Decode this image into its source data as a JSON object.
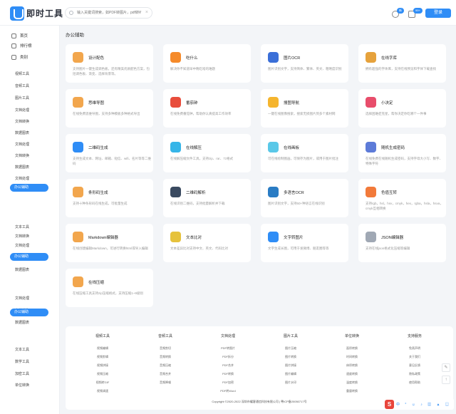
{
  "header": {
    "brand": "即时工具",
    "search_placeholder": "输入关键词搜索，如PDF转图片，pdf转Word等",
    "badge1": "新",
    "badge2": "99+",
    "login": "登录"
  },
  "colors": {
    "accent": "#2f8df6"
  },
  "sidebar": {
    "home": "首页",
    "rank": "排行榜",
    "category": "类别",
    "items": [
      "视频工具",
      "音频工具",
      "图片工具",
      "文档处理",
      "文档转换",
      "数据图表",
      "文档处理",
      "文档转换",
      "数据图表",
      "文档处理",
      "文档转换",
      "办公辅助",
      "文本工具",
      "文档转换",
      "文档处理",
      "文档转换",
      "数据图表",
      "办公辅助",
      "文档处理",
      "文档转换",
      "数据图表",
      "办公辅助",
      "文本工具",
      "数学工具",
      "加密工具",
      "单位转换"
    ]
  },
  "section_title": "办公辅助",
  "cards": [
    {
      "title": "设计配色",
      "desc": "支持图片一键生成调色板，还有精美优质配色方案，包括调色板、渐变、选择背景等。",
      "icon": "palette-icon",
      "color": "#f2a64d"
    },
    {
      "title": "吃什么",
      "desc": "解决你不知道早中晚吃啥的难题",
      "icon": "food-icon",
      "color": "#f58a2a"
    },
    {
      "title": "图片OCR",
      "desc": "图片识别文字，支持简体、繁体、英文、粗略度识别",
      "icon": "ocr-icon",
      "color": "#3b6fd8"
    },
    {
      "title": "在线字库",
      "desc": "拥有超强的字体库，支持在线预览和字体下载查找",
      "icon": "font-library-icon",
      "color": "#e6a23c"
    },
    {
      "title": "思维导图",
      "desc": "在线免费思维导图，支持多种模板多种格式导出",
      "icon": "mindmap-icon",
      "color": "#f2a64d"
    },
    {
      "title": "番茄钟",
      "desc": "在线免费番茄钟，帮助你认真提高工作效率",
      "icon": "tomato-icon",
      "color": "#e84d3c"
    },
    {
      "title": "搜图导航",
      "desc": "一键在线图像搜索，搜索无损图片到多个素材网",
      "icon": "search-image-icon",
      "color": "#f5b52e"
    },
    {
      "title": "小决定",
      "desc": "选择困难症克星，帮你决定你吃哪个一件事",
      "icon": "dice-icon",
      "color": "#e84d6b"
    },
    {
      "title": "二维码生成",
      "desc": "支持生成文本、网址、邮箱、短信、wifi、名片等等二维码",
      "icon": "qrcode-icon",
      "color": "#2f8df6"
    },
    {
      "title": "在线解压",
      "desc": "在线解压缩文件工具，支持zip、rar、7z格式",
      "icon": "folder-icon",
      "color": "#36b5e8"
    },
    {
      "title": "在线画板",
      "desc": "可在线绘制图画，可保存为图片，或用于图片批注",
      "icon": "drawing-board-icon",
      "color": "#5ac8e8"
    },
    {
      "title": "随机生成密码",
      "desc": "在线免费在线随机生成密码，支持字母大小写、数字、特殊字符",
      "icon": "password-icon",
      "color": "#5d7bd8"
    },
    {
      "title": "条形码生成",
      "desc": "支持十种条形码在线生成，可批量生成",
      "icon": "barcode-icon",
      "color": "#f2a64d"
    },
    {
      "title": "二维码解析",
      "desc": "在线识别二维码，支持批量解析并下载",
      "icon": "qr-scan-icon",
      "color": "#3a4a60"
    },
    {
      "title": "多语言OCR",
      "desc": "图片识别文字，支持50+种语言在线识别",
      "icon": "globe-ocr-icon",
      "color": "#2a7cc4"
    },
    {
      "title": "色值互转",
      "desc": "支持rgb，hsl，hsv，cmyk，hex，rgba，hsla，hsva，cmyk互相转换",
      "icon": "color-convert-icon",
      "color": "#f27a3a"
    },
    {
      "title": "Markdown编辑器",
      "desc": "在线创建编辑Markdown，可进行转换html或导入编辑",
      "icon": "markdown-icon",
      "color": "#f2a64d"
    },
    {
      "title": "文本比对",
      "desc": "文本差异比对支持中文、英文、代码比对",
      "icon": "text-compare-icon",
      "color": "#e6c23c"
    },
    {
      "title": "文字转图片",
      "desc": "文字生成长图，可用于发微博、朋友圈等等",
      "icon": "text-image-icon",
      "color": "#2f8df6"
    },
    {
      "title": "JSON编辑器",
      "desc": "支持在线json格式化压缩等编辑",
      "icon": "json-icon",
      "color": "#a0a8b4"
    },
    {
      "title": "在线压缩",
      "desc": "在线压缩工具支持zip压缩格式，支持压缩1~9级别",
      "icon": "compress-icon",
      "color": "#f2a64d"
    }
  ],
  "footer": {
    "columns": [
      {
        "title": "视频工具",
        "links": [
          "视频编辑",
          "视频剪辑",
          "视频拼接",
          "视频压缩",
          "视频转GIF",
          "视频调速"
        ]
      },
      {
        "title": "音频工具",
        "links": [
          "音频剪切",
          "音频转换",
          "音频压缩",
          "音频合并",
          "音频降噪"
        ]
      },
      {
        "title": "文档处理",
        "links": [
          "PDF转图片",
          "PDF拆分",
          "PDF合并",
          "PDF转换",
          "PDF加密",
          "PDF转Word"
        ]
      },
      {
        "title": "图片工具",
        "links": [
          "图片压缩",
          "图片转换",
          "图片拼接",
          "图片编辑",
          "图片水印"
        ]
      },
      {
        "title": "单位转换",
        "links": [
          "面积转换",
          "时间转换",
          "体积转换",
          "速度转换",
          "温度转换",
          "重量转换"
        ]
      },
      {
        "title": "支持服务",
        "links": [
          "免责声明",
          "关于我们",
          "意见反馈",
          "隐私政策",
          "使用帮助"
        ]
      }
    ],
    "copyright": "Copyright ©2020-2022 深圳市耀客通信科技有限公司 | 粤ICP备20050717号"
  }
}
